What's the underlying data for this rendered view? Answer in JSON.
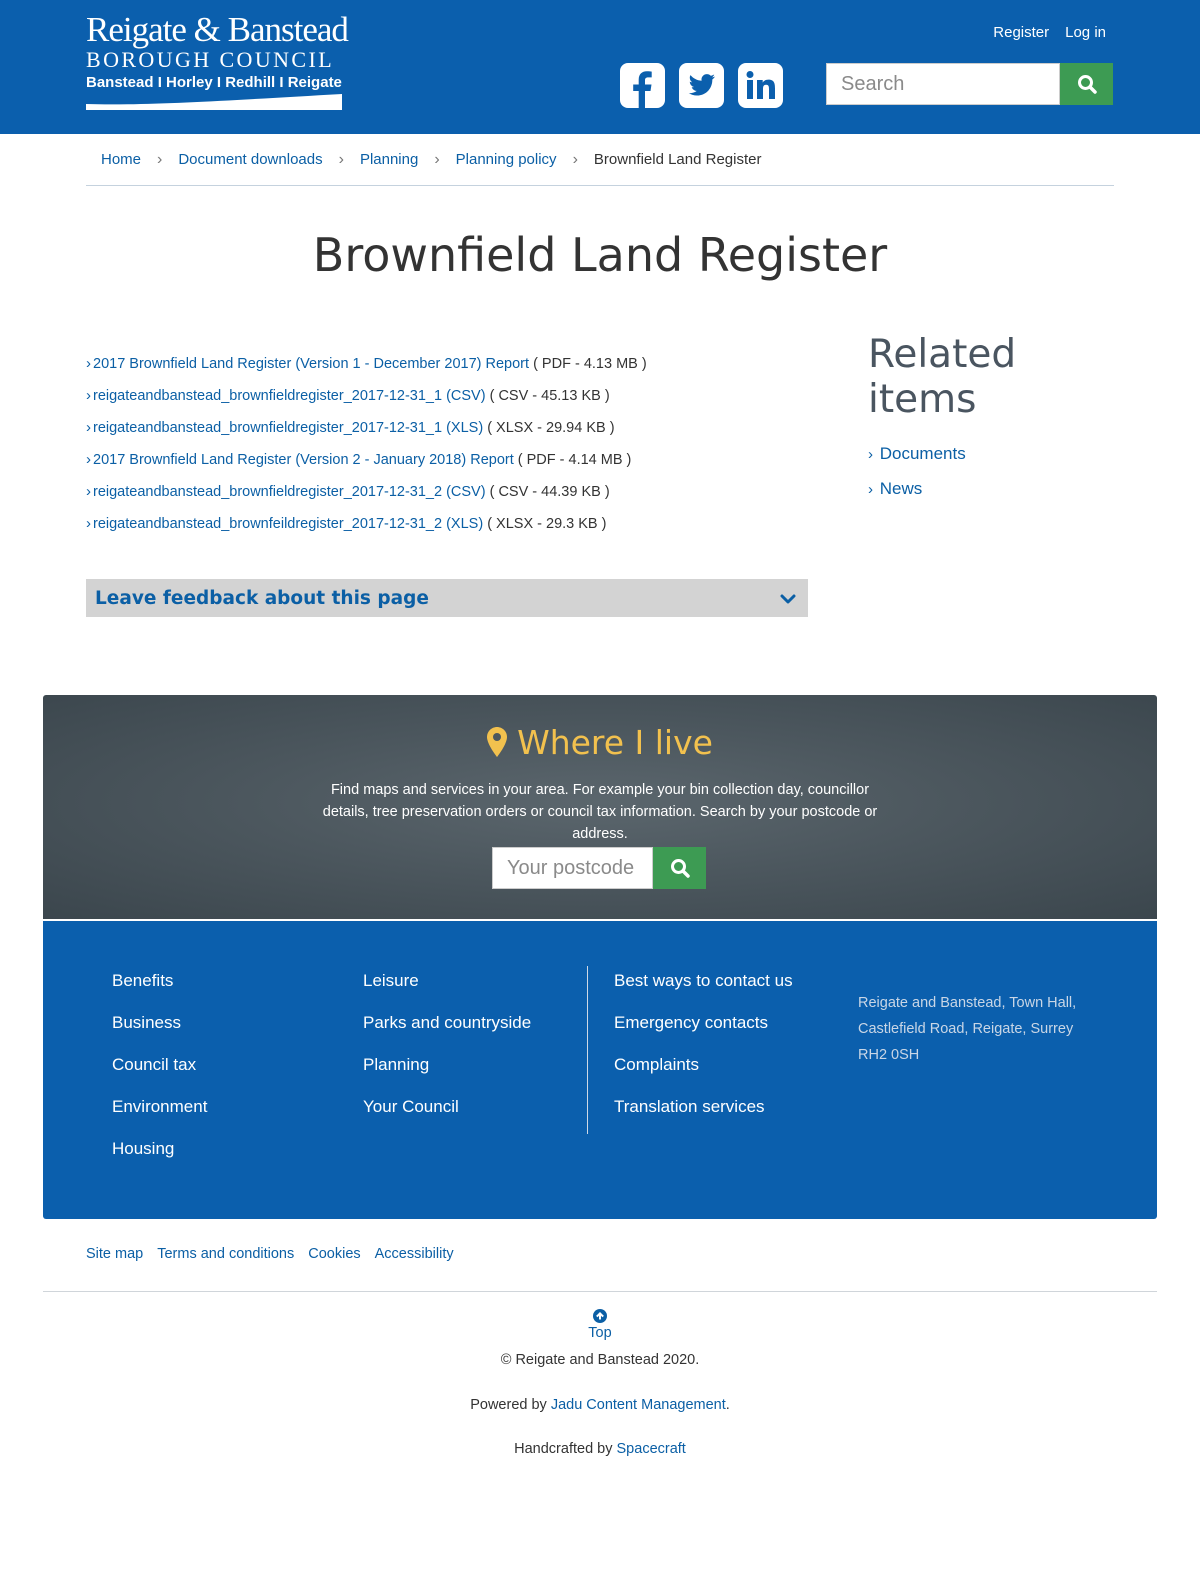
{
  "header": {
    "logo": {
      "line1": "Reigate & Banstead",
      "line2": "BOROUGH COUNCIL",
      "line3": "Banstead I Horley I Redhill I Reigate"
    },
    "top_links": {
      "register": "Register",
      "login": "Log in"
    },
    "social_icons": [
      "facebook-icon",
      "twitter-icon",
      "linkedin-icon"
    ],
    "search": {
      "placeholder": "Search",
      "icon": "search-icon"
    },
    "color": "#0b5fad"
  },
  "breadcrumb": [
    "Home",
    "Document downloads",
    "Planning",
    "Planning policy",
    "Brownfield Land Register"
  ],
  "page_title": "Brownfield Land Register",
  "downloads": [
    {
      "link": "2017 Brownfield Land Register (Version 1 - December 2017) Report",
      "meta": "( PDF - 4.13 MB )"
    },
    {
      "link": "reigateandbanstead_brownfieldregister_2017-12-31_1 (CSV)",
      "meta": "( CSV - 45.13 KB )"
    },
    {
      "link": "reigateandbanstead_brownfieldregister_2017-12-31_1 (XLS)",
      "meta": "( XLSX - 29.94 KB )"
    },
    {
      "link": "2017 Brownfield Land Register (Version 2 - January 2018) Report",
      "meta": "( PDF - 4.14 MB )"
    },
    {
      "link": "reigateandbanstead_brownfieldregister_2017-12-31_2 (CSV)",
      "meta": "( CSV - 44.39 KB )"
    },
    {
      "link": "reigateandbanstead_brownfeildregister_2017-12-31_2 (XLS)",
      "meta": "( XLSX - 29.3 KB )"
    }
  ],
  "feedback": {
    "label": "Leave feedback about this page",
    "icon": "chevron-down-icon"
  },
  "related": {
    "heading_line1": "Related",
    "heading_line2": "items",
    "items": [
      "Documents",
      "News"
    ]
  },
  "where_i_live": {
    "title": "Where I live",
    "icon": "map-marker-icon",
    "description": "Find maps and services in your area. For example your bin collection day, councillor details, tree preservation orders or council tax information. Search by your postcode or address.",
    "postcode_placeholder": "Your postcode",
    "accent": "#f2c14e"
  },
  "footer": {
    "col1": [
      "Benefits",
      "Business",
      "Council tax",
      "Environment",
      "Housing"
    ],
    "col2": [
      "Leisure",
      "Parks and countryside",
      "Planning",
      "Your Council"
    ],
    "col3": [
      "Best ways to contact us",
      "Emergency contacts",
      "Complaints",
      "Translation services"
    ],
    "address": {
      "line1": "Reigate and Banstead, Town Hall,",
      "line2": "Castlefield Road, Reigate, Surrey",
      "line3": "RH2 0SH"
    }
  },
  "bottom_links": [
    "Site map",
    "Terms and conditions",
    "Cookies",
    "Accessibility"
  ],
  "top_link": "Top",
  "copyright": "© Reigate and Banstead 2020.",
  "powered": {
    "prefix": "Powered by ",
    "link": "Jadu Content Management",
    "suffix": "."
  },
  "handcrafted": {
    "prefix": "Handcrafted by ",
    "link": "Spacecraft"
  },
  "colors": {
    "brand_blue": "#0b5fad",
    "link": "#0b5fa5",
    "search_green": "#3d9b53"
  }
}
